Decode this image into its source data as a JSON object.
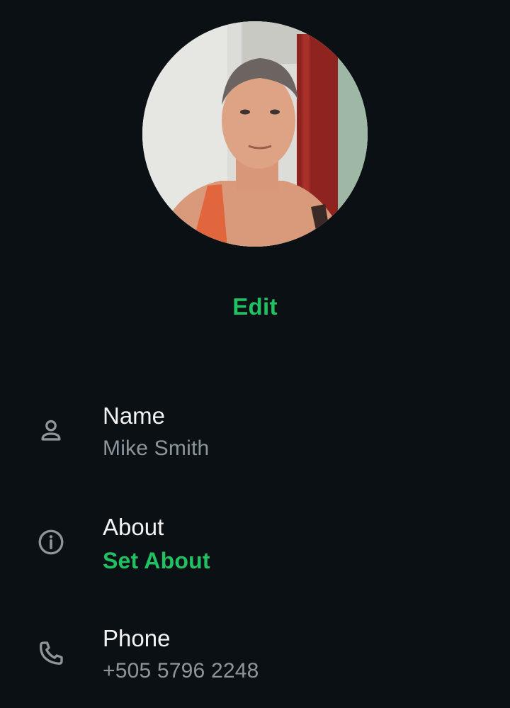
{
  "profile": {
    "edit_label": "Edit"
  },
  "rows": [
    {
      "icon": "person-icon",
      "title": "Name",
      "value": "Mike Smith"
    },
    {
      "icon": "info-icon",
      "title": "About",
      "value": "Set About"
    },
    {
      "icon": "phone-icon",
      "title": "Phone",
      "value": "+505 5796 2248"
    }
  ],
  "colors": {
    "background": "#0b1014",
    "accent": "#21c063",
    "secondary_text": "#8c969c",
    "primary_text": "#f1f3f4"
  }
}
